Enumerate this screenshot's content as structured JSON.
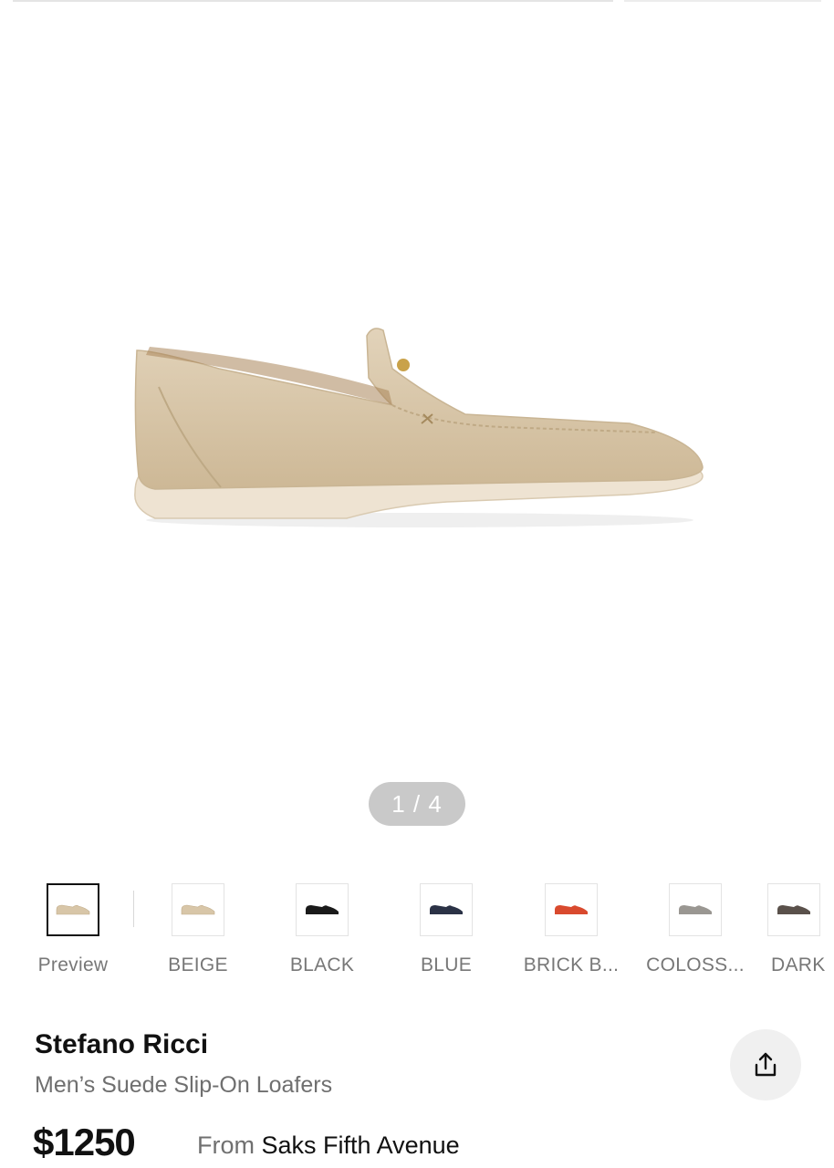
{
  "gallery": {
    "pager_text": "1 / 4",
    "image_icon": "loafer-image"
  },
  "swatches": [
    {
      "label": "Preview",
      "color": "#d8c6a8",
      "selected": true
    },
    {
      "label": "BEIGE",
      "color": "#d8c6a8",
      "selected": false
    },
    {
      "label": "BLACK",
      "color": "#1a1a1a",
      "selected": false
    },
    {
      "label": "BLUE",
      "color": "#2b3246",
      "selected": false
    },
    {
      "label": "BRICK B...",
      "color": "#d94a2e",
      "selected": false
    },
    {
      "label": "COLOSS...",
      "color": "#9a9792",
      "selected": false
    },
    {
      "label": "DARK",
      "color": "#5a514b",
      "selected": false
    }
  ],
  "product": {
    "brand": "Stefano Ricci",
    "name": "Men’s Suede Slip-On Loafers",
    "price": "$1250",
    "from_label": "From",
    "store": "Saks Fifth Avenue"
  },
  "actions": {
    "share_icon": "share-icon"
  }
}
